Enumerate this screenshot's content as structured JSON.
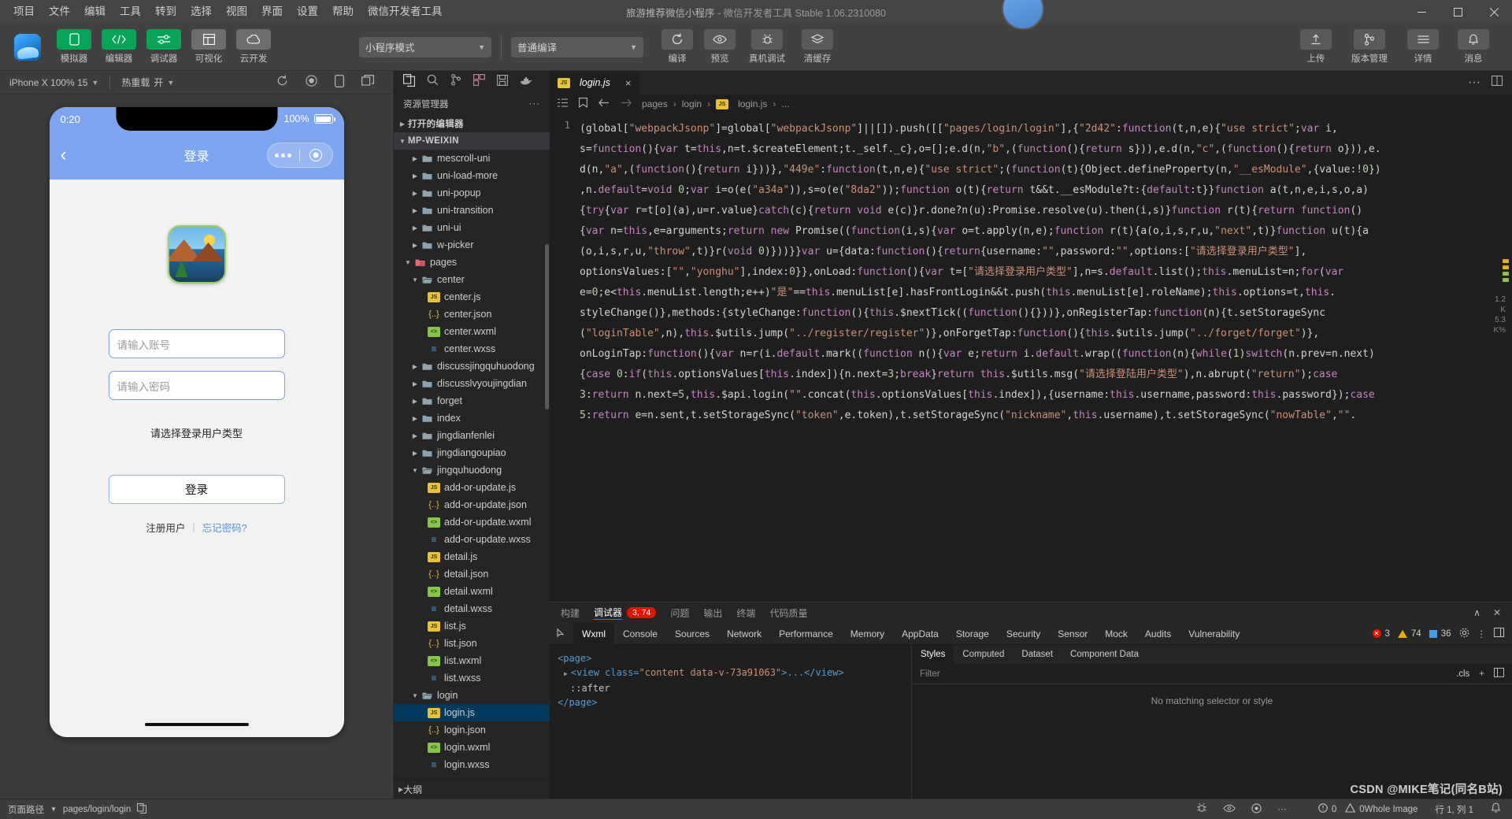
{
  "window": {
    "title_project": "旅游推荐微信小程序",
    "title_sep": "-",
    "title_app": "微信开发者工具",
    "title_version": "Stable 1.06.2310080",
    "minimize": "minimize-icon",
    "maximize": "maximize-icon",
    "close": "close-icon"
  },
  "menubar": {
    "items": [
      "项目",
      "文件",
      "编辑",
      "工具",
      "转到",
      "选择",
      "视图",
      "界面",
      "设置",
      "帮助",
      "微信开发者工具"
    ]
  },
  "toolbar": {
    "left_tools": [
      {
        "label": "模拟器",
        "icon": "phone-icon",
        "style": "green"
      },
      {
        "label": "编辑器",
        "icon": "code-icon",
        "style": "green"
      },
      {
        "label": "调试器",
        "icon": "sliders-icon",
        "style": "green"
      },
      {
        "label": "可视化",
        "icon": "layout-icon",
        "style": "grey"
      },
      {
        "label": "云开发",
        "icon": "cloud-icon",
        "style": "grey"
      }
    ],
    "mode_select": "小程序模式",
    "compile_select": "普通编译",
    "actions": [
      {
        "label": "编译",
        "icon": "refresh-icon"
      },
      {
        "label": "预览",
        "icon": "eye-icon"
      },
      {
        "label": "真机调试",
        "icon": "bug-icon"
      },
      {
        "label": "清缓存",
        "icon": "layers-icon"
      }
    ],
    "right_tools": [
      {
        "label": "上传",
        "icon": "upload-icon"
      },
      {
        "label": "版本管理",
        "icon": "branch-icon"
      },
      {
        "label": "详情",
        "icon": "menu-icon"
      },
      {
        "label": "消息",
        "icon": "bell-icon"
      }
    ]
  },
  "simulator": {
    "device": "iPhone X 100% 15",
    "hotreload_label": "热重载",
    "hotreload_value": "开",
    "icons": [
      "refresh-icon",
      "record-icon",
      "rotate-icon",
      "window-icon"
    ],
    "phone": {
      "time": "0:20",
      "battery": "100%",
      "nav_title": "登录",
      "back_icon": "chevron-left-icon",
      "username_placeholder": "请输入账号",
      "password_placeholder": "请输入密码",
      "usertype_label": "请选择登录用户类型",
      "login_button": "登录",
      "register_link": "注册用户",
      "link_divider": "|",
      "forgot_link": "忘记密码?"
    }
  },
  "explorer": {
    "activity_icons": [
      "files-icon",
      "search-icon",
      "source-control-icon",
      "extensions-icon",
      "save-icon",
      "docker-icon"
    ],
    "title": "资源管理器",
    "more": "···",
    "open_editors": "打开的编辑器",
    "project_root": "MP-WEIXIN",
    "outline": "大纲",
    "tree": [
      {
        "label": "mescroll-uni",
        "type": "folder",
        "indent": 2,
        "expanded": false
      },
      {
        "label": "uni-load-more",
        "type": "folder",
        "indent": 2,
        "expanded": false
      },
      {
        "label": "uni-popup",
        "type": "folder",
        "indent": 2,
        "expanded": false
      },
      {
        "label": "uni-transition",
        "type": "folder",
        "indent": 2,
        "expanded": false
      },
      {
        "label": "uni-ui",
        "type": "folder",
        "indent": 2,
        "expanded": false
      },
      {
        "label": "w-picker",
        "type": "folder",
        "indent": 2,
        "expanded": false
      },
      {
        "label": "pages",
        "type": "folder-pink",
        "indent": 1,
        "expanded": true
      },
      {
        "label": "center",
        "type": "folder-open",
        "indent": 2,
        "expanded": true
      },
      {
        "label": "center.js",
        "type": "js",
        "indent": 3
      },
      {
        "label": "center.json",
        "type": "json",
        "indent": 3
      },
      {
        "label": "center.wxml",
        "type": "wxml",
        "indent": 3
      },
      {
        "label": "center.wxss",
        "type": "wxss",
        "indent": 3
      },
      {
        "label": "discussjingquhuodong",
        "type": "folder",
        "indent": 2,
        "expanded": false
      },
      {
        "label": "discusslvyoujingdian",
        "type": "folder",
        "indent": 2,
        "expanded": false
      },
      {
        "label": "forget",
        "type": "folder",
        "indent": 2,
        "expanded": false
      },
      {
        "label": "index",
        "type": "folder",
        "indent": 2,
        "expanded": false
      },
      {
        "label": "jingdianfenlei",
        "type": "folder",
        "indent": 2,
        "expanded": false
      },
      {
        "label": "jingdiangoupiao",
        "type": "folder",
        "indent": 2,
        "expanded": false
      },
      {
        "label": "jingquhuodong",
        "type": "folder-open",
        "indent": 2,
        "expanded": true
      },
      {
        "label": "add-or-update.js",
        "type": "js",
        "indent": 3
      },
      {
        "label": "add-or-update.json",
        "type": "json",
        "indent": 3
      },
      {
        "label": "add-or-update.wxml",
        "type": "wxml",
        "indent": 3
      },
      {
        "label": "add-or-update.wxss",
        "type": "wxss",
        "indent": 3
      },
      {
        "label": "detail.js",
        "type": "js",
        "indent": 3
      },
      {
        "label": "detail.json",
        "type": "json",
        "indent": 3
      },
      {
        "label": "detail.wxml",
        "type": "wxml",
        "indent": 3
      },
      {
        "label": "detail.wxss",
        "type": "wxss",
        "indent": 3
      },
      {
        "label": "list.js",
        "type": "js",
        "indent": 3
      },
      {
        "label": "list.json",
        "type": "json",
        "indent": 3
      },
      {
        "label": "list.wxml",
        "type": "wxml",
        "indent": 3
      },
      {
        "label": "list.wxss",
        "type": "wxss",
        "indent": 3
      },
      {
        "label": "login",
        "type": "folder-open",
        "indent": 2,
        "expanded": true
      },
      {
        "label": "login.js",
        "type": "js",
        "indent": 3,
        "active": true
      },
      {
        "label": "login.json",
        "type": "json",
        "indent": 3
      },
      {
        "label": "login.wxml",
        "type": "wxml",
        "indent": 3
      },
      {
        "label": "login.wxss",
        "type": "wxss",
        "indent": 3
      }
    ]
  },
  "editor": {
    "tab_label": "login.js",
    "tab_icon": "js-file-icon",
    "tab_close": "×",
    "breadcrumb": [
      "pages",
      "login",
      "login.js",
      "..."
    ],
    "breadcrumb_icons": [
      "outline-icon",
      "bookmark-icon",
      "back-arrow-icon",
      "forward-arrow-icon"
    ],
    "line_number": "1",
    "minimap_numbers": [
      "1.2",
      "K",
      "5.3",
      "K%"
    ],
    "code_lines": [
      "(global[\"webpackJsonp\"]=global[\"webpackJsonp\"]||[]).push([[\"pages/login/login\"],{\"2d42\":function(t,n,e){\"use strict\";var i,",
      "s=function(){var t=this,n=t.$createElement;t._self._c},o=[];e.d(n,\"b\",(function(){return s})),e.d(n,\"c\",(function(){return o})),e.",
      "d(n,\"a\",(function(){return i}))},\"449e\":function(t,n,e){\"use strict\";(function(t){Object.defineProperty(n,\"__esModule\",{value:!0})",
      ",n.default=void 0;var i=o(e(\"a34a\")),s=o(e(\"8da2\"));function o(t){return t&&t.__esModule?t:{default:t}}function a(t,n,e,i,s,o,a)",
      "{try{var r=t[o](a),u=r.value}catch(c){return void e(c)}r.done?n(u):Promise.resolve(u).then(i,s)}function r(t){return function()",
      "{var n=this,e=arguments;return new Promise((function(i,s){var o=t.apply(n,e);function r(t){a(o,i,s,r,u,\"next\",t)}function u(t){a",
      "(o,i,s,r,u,\"throw\",t)}r(void 0)}))}}var u={data:function(){return{username:\"\",password:\"\",options:[\"请选择登录用户类型\"],",
      "optionsValues:[\"\",\"yonghu\"],index:0}},onLoad:function(){var t=[\"请选择登录用户类型\"],n=s.default.list();this.menuList=n;for(var",
      "e=0;e<this.menuList.length;e++)\"是\"==this.menuList[e].hasFrontLogin&&t.push(this.menuList[e].roleName);this.options=t,this.",
      "styleChange()},methods:{styleChange:function(){this.$nextTick((function(){}))},onRegisterTap:function(n){t.setStorageSync",
      "(\"loginTable\",n),this.$utils.jump(\"../register/register\")},onForgetTap:function(){this.$utils.jump(\"../forget/forget\")},",
      "onLoginTap:function(){var n=r(i.default.mark((function n(){var e;return i.default.wrap((function(n){while(1)switch(n.prev=n.next)",
      "{case 0:if(this.optionsValues[this.index]){n.next=3;break}return this.$utils.msg(\"请选择登陆用户类型\"),n.abrupt(\"return\");case",
      "3:return n.next=5,this.$api.login(\"\".concat(this.optionsValues[this.index]),{username:this.username,password:this.password});case",
      "5:return e=n.sent,t.setStorageSync(\"token\",e.token),t.setStorageSync(\"nickname\",this.username),t.setStorageSync(\"nowTable\",\"\"."
    ]
  },
  "devtools": {
    "top_tabs": [
      "构建",
      "调试器",
      "问题",
      "输出",
      "终端",
      "代码质量"
    ],
    "active_top_tab": "调试器",
    "badge": "3, 74",
    "collapse_icon": "chevron-up-icon",
    "close_icon": "close-icon",
    "panel_tabs": [
      "Wxml",
      "Console",
      "Sources",
      "Network",
      "Performance",
      "Memory",
      "AppData",
      "Storage",
      "Security",
      "Sensor",
      "Mock",
      "Audits",
      "Vulnerability"
    ],
    "active_panel_tab": "Wxml",
    "pick_icon": "inspect-icon",
    "counts": {
      "errors": "3",
      "warnings": "74",
      "infos": "36"
    },
    "settings_icon": "gear-icon",
    "more_icon": "more-vertical-icon",
    "dock_icon": "dock-icon",
    "wxml_tree": {
      "open_tag": "<page>",
      "view_line_prefix": "<view class=",
      "view_class": "\"content data-v-73a91063\"",
      "view_line_suffix": ">...</view>",
      "pseudo": "::after",
      "close_tag": "</page>"
    },
    "style_tabs": [
      "Styles",
      "Computed",
      "Dataset",
      "Component Data"
    ],
    "active_style_tab": "Styles",
    "filter_placeholder": "Filter",
    "cls_button": ".cls",
    "add_icon": "plus-icon",
    "layout_icon": "layout-icon",
    "no_match": "No matching selector or style"
  },
  "statusbar": {
    "path_label": "页面路径",
    "path_value": "pages/login/login",
    "copy_icon": "copy-icon",
    "icons": [
      "bug-icon",
      "eye-icon",
      "radio-icon",
      "more-icon"
    ],
    "errors": "0",
    "warnings": "0",
    "whole_image": "Whole Image",
    "cursor_position": "行 1, 列 1",
    "bell_icon": "bell-icon"
  },
  "watermark": "CSDN @MIKE笔记(同名B站)",
  "colors": {
    "accent_green": "#07a457",
    "phone_blue": "#7da4ee",
    "editor_bg": "#1e1e1e",
    "panel_bg": "#252526",
    "chrome_bg": "#3c3c3c",
    "link_blue": "#5d8fd6"
  }
}
